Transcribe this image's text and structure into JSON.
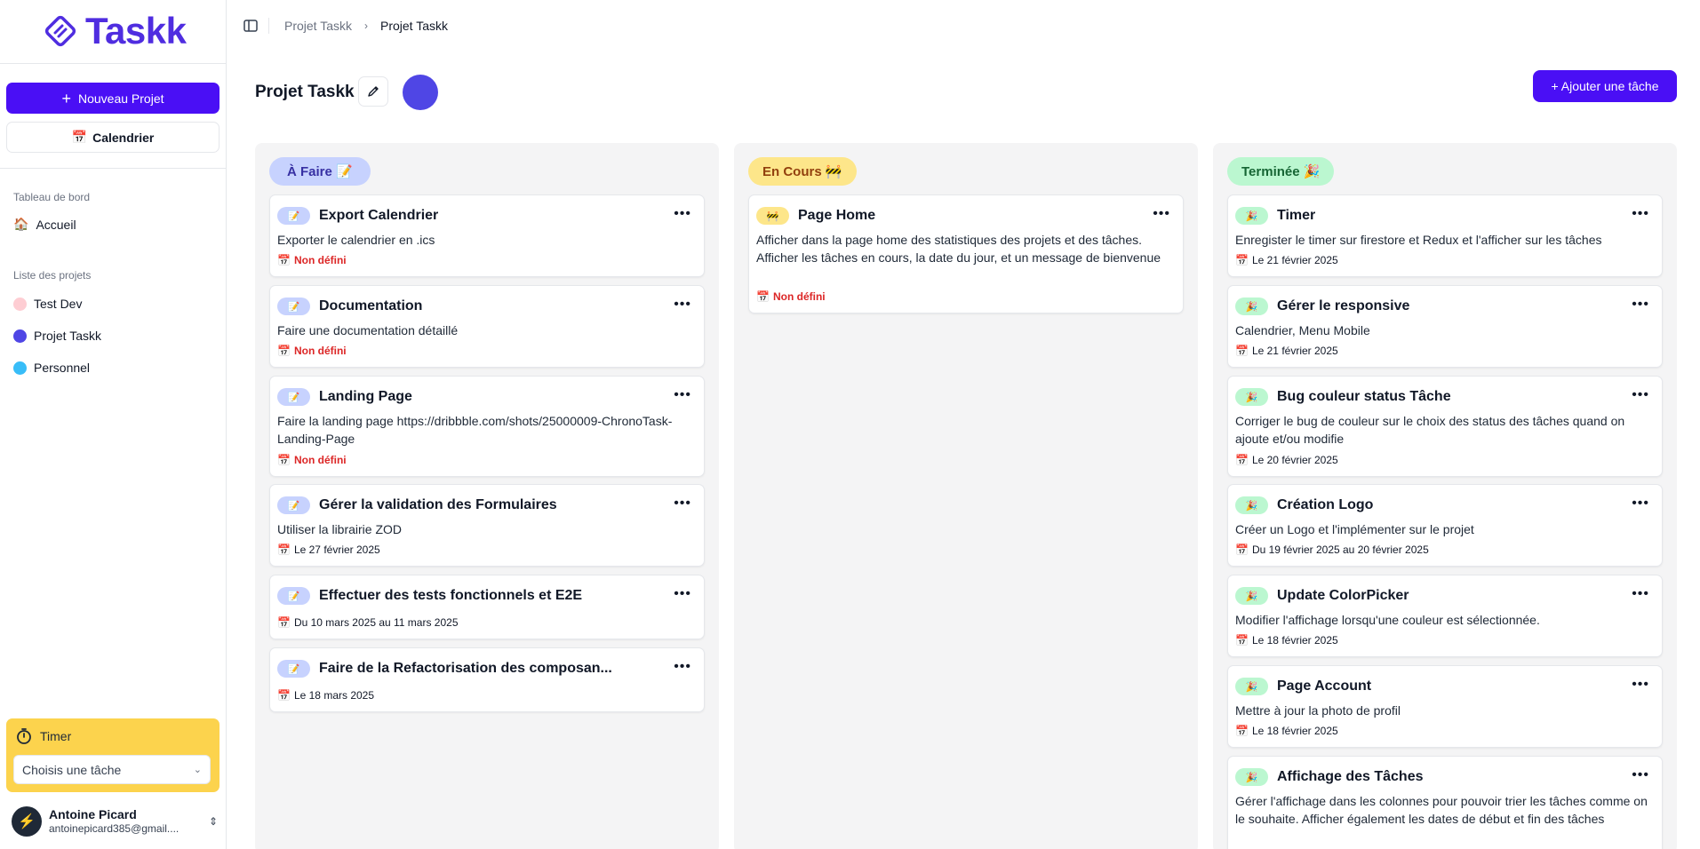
{
  "app": {
    "name": "Taskk"
  },
  "sidebar": {
    "new_project_label": "Nouveau Projet",
    "calendar_label": "Calendrier",
    "dashboard_section": "Tableau de bord",
    "home_label": "Accueil",
    "projects_section": "Liste des projets",
    "projects": [
      {
        "label": "Test Dev",
        "color": "#fecdd3"
      },
      {
        "label": "Projet Taskk",
        "color": "#4f46e5"
      },
      {
        "label": "Personnel",
        "color": "#38bdf8"
      }
    ],
    "timer": {
      "label": "Timer",
      "select_placeholder": "Choisis une tâche"
    },
    "user": {
      "name": "Antoine Picard",
      "email": "antoinepicard385@gmail...."
    }
  },
  "breadcrumb": {
    "parent": "Projet Taskk",
    "current": "Projet Taskk"
  },
  "project": {
    "title": "Projet Taskk",
    "color": "#4f46e5",
    "add_task_label": "+ Ajouter une tâche"
  },
  "columns": [
    {
      "label": "À Faire 📝",
      "badge_bg": "#c7d2fe",
      "badge_color": "#3730a3",
      "pill_emoji": "📝",
      "pill_bg": "#c7d2fe",
      "cards": [
        {
          "title": "Export Calendrier",
          "desc": "Exporter le calendrier en .ics",
          "date": "Non défini",
          "undefined": true
        },
        {
          "title": "Documentation",
          "desc": "Faire une documentation détaillé",
          "date": "Non défini",
          "undefined": true
        },
        {
          "title": "Landing Page",
          "desc": "Faire la landing page https://dribbble.com/shots/25000009-ChronoTask-Landing-Page",
          "date": "Non défini",
          "undefined": true
        },
        {
          "title": "Gérer la validation des Formulaires",
          "desc": "Utiliser la librairie ZOD",
          "date": "Le 27 février 2025",
          "undefined": false
        },
        {
          "title": "Effectuer des tests fonctionnels et E2E",
          "desc": "",
          "date": "Du 10 mars 2025 au 11 mars 2025",
          "undefined": false
        },
        {
          "title": "Faire de la Refactorisation des composan...",
          "desc": "",
          "date": "Le 18 mars 2025",
          "undefined": false
        }
      ]
    },
    {
      "label": "En Cours 🚧",
      "badge_bg": "#fde68a",
      "badge_color": "#92400e",
      "pill_emoji": "🚧",
      "pill_bg": "#fde68a",
      "cards": [
        {
          "title": "Page Home",
          "desc": "Afficher dans la page home des statistiques des projets et des tâches. Afficher les tâches en cours, la date du jour, et un message de bienvenue",
          "date": "Non défini",
          "undefined": true
        }
      ]
    },
    {
      "label": "Terminée 🎉",
      "badge_bg": "#bbf7d0",
      "badge_color": "#166534",
      "pill_emoji": "🎉",
      "pill_bg": "#bbf7d0",
      "cards": [
        {
          "title": "Timer",
          "desc": "Enregister le timer sur firestore et Redux et l'afficher sur les tâches",
          "date": "Le 21 février 2025",
          "undefined": false
        },
        {
          "title": "Gérer le responsive",
          "desc": "Calendrier, Menu Mobile",
          "date": "Le 21 février 2025",
          "undefined": false
        },
        {
          "title": "Bug couleur status Tâche",
          "desc": "Corriger le bug de couleur sur le choix des status des tâches quand on ajoute et/ou modifie",
          "date": "Le 20 février 2025",
          "undefined": false
        },
        {
          "title": "Création Logo",
          "desc": "Créer un Logo et l'implémenter sur le projet",
          "date": "Du 19 février 2025 au 20 février 2025",
          "undefined": false
        },
        {
          "title": "Update ColorPicker",
          "desc": "Modifier l'affichage lorsqu'une couleur est sélectionnée.",
          "date": "Le 18 février 2025",
          "undefined": false
        },
        {
          "title": "Page Account",
          "desc": "Mettre à jour la photo de profil",
          "date": "Le 18 février 2025",
          "undefined": false
        },
        {
          "title": "Affichage des Tâches",
          "desc": "Gérer l'affichage dans les colonnes pour pouvoir trier les tâches comme on le souhaite. Afficher également les dates de début et fin des tâches",
          "date": "",
          "undefined": false
        }
      ]
    }
  ]
}
